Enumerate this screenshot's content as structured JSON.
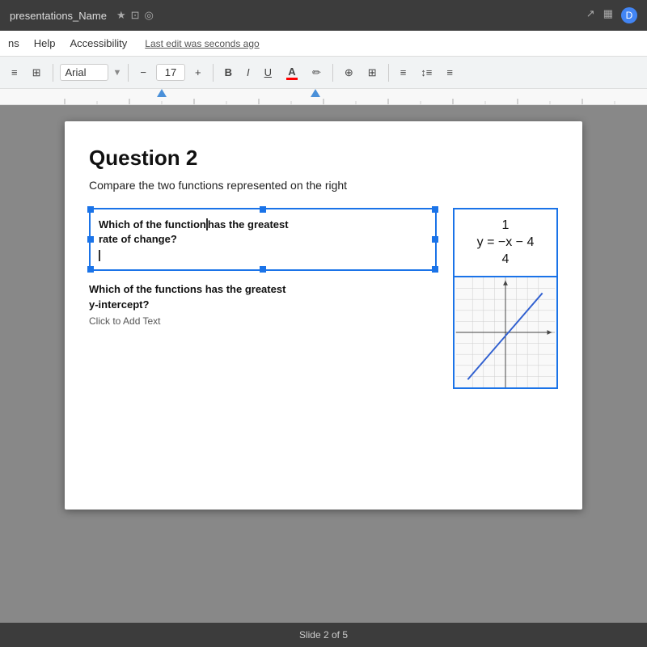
{
  "titleBar": {
    "title": "presentations_Name",
    "starIcon": "★",
    "saveIcon": "⊡",
    "cloudIcon": "◎",
    "trendIcon": "↗",
    "gridIcon": "▦",
    "profileIcon": "D"
  },
  "menuBar": {
    "items": [
      "ns",
      "Help",
      "Accessibility"
    ],
    "lastEdit": "Last edit was seconds ago"
  },
  "toolbar": {
    "menuIcon": "≡",
    "gridIcon": "⊞",
    "fontName": "Arial",
    "fontSizeDecrease": "−",
    "fontSize": "17",
    "fontSizeIncrease": "+",
    "boldLabel": "B",
    "italicLabel": "I",
    "underlineLabel": "U",
    "colorLabel": "A",
    "paintIcon": "✏",
    "linkIcon": "⊕",
    "tableIcon": "⊞",
    "alignIcon": "≡",
    "lineSpacingIcon": "↕",
    "listIcon": "≡"
  },
  "slide": {
    "title": "Question 2",
    "subtitle": "Compare the two functions represented on the right",
    "question1": "Which of the function has the greatest\nrate of change?",
    "question2": "Which of the functions has the greatest\ny-intercept?",
    "clickToAdd": "Click to Add Text",
    "equation": {
      "numerator": "1",
      "variable": "y = −x − 4",
      "denominator": "4"
    },
    "graph": {
      "hasGrid": true,
      "hasDiagonalLine": true
    }
  },
  "bottomBar": {
    "pageInfo": "Slide 2 of 5"
  }
}
